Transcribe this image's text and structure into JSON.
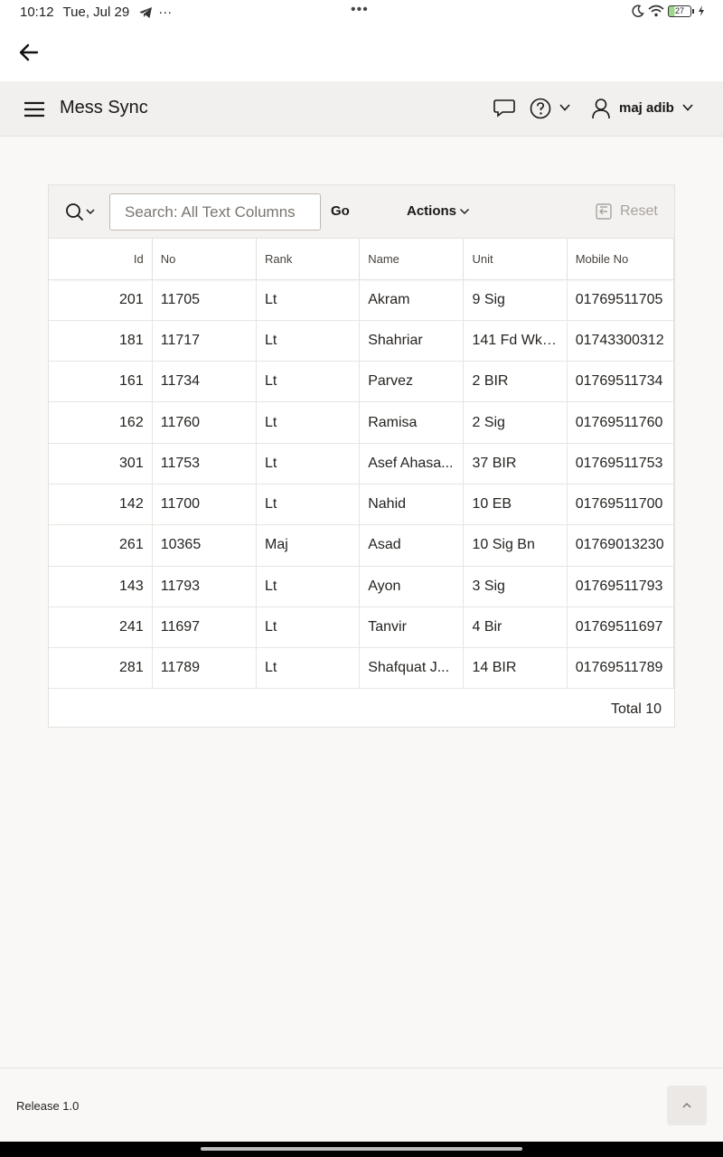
{
  "status_bar": {
    "time": "10:12",
    "date": "Tue, Jul 29",
    "extra": "···",
    "center_dots": "•••",
    "battery": "27"
  },
  "header": {
    "app_title": "Mess Sync",
    "user_name": "maj adib"
  },
  "report": {
    "search_placeholder": "Search: All Text Columns",
    "go_label": "Go",
    "actions_label": "Actions",
    "reset_label": "Reset",
    "columns": [
      "Id",
      "No",
      "Rank",
      "Name",
      "Unit",
      "Mobile No"
    ],
    "rows": [
      [
        "201",
        "11705",
        "Lt",
        "Akram",
        "9 Sig",
        "01769511705"
      ],
      [
        "181",
        "11717",
        "Lt",
        "Shahriar",
        "141 Fd Wks...",
        "01743300312"
      ],
      [
        "161",
        "11734",
        "Lt",
        "Parvez",
        "2 BIR",
        "01769511734"
      ],
      [
        "162",
        "11760",
        "Lt",
        "Ramisa",
        "2 Sig",
        "01769511760"
      ],
      [
        "301",
        "11753",
        "Lt",
        "Asef Ahasa...",
        "37 BIR",
        "01769511753"
      ],
      [
        "142",
        "11700",
        "Lt",
        "Nahid",
        "10 EB",
        "01769511700"
      ],
      [
        "261",
        "10365",
        "Maj",
        "Asad",
        "10 Sig Bn",
        "01769013230"
      ],
      [
        "143",
        "11793",
        "Lt",
        "Ayon",
        "3 Sig",
        "01769511793"
      ],
      [
        "241",
        "11697",
        "Lt",
        "Tanvir",
        "4 Bir",
        "01769511697"
      ],
      [
        "281",
        "11789",
        "Lt",
        "Shafquat J...",
        "14 BIR",
        "01769511789"
      ]
    ],
    "total_label": "Total 10"
  },
  "footer": {
    "release": "Release 1.0"
  },
  "icons": [
    "back-arrow-icon",
    "hamburger-icon",
    "chat-icon",
    "help-icon",
    "chevron-down-icon",
    "user-icon",
    "search-icon",
    "reset-icon",
    "chevron-up-icon"
  ]
}
